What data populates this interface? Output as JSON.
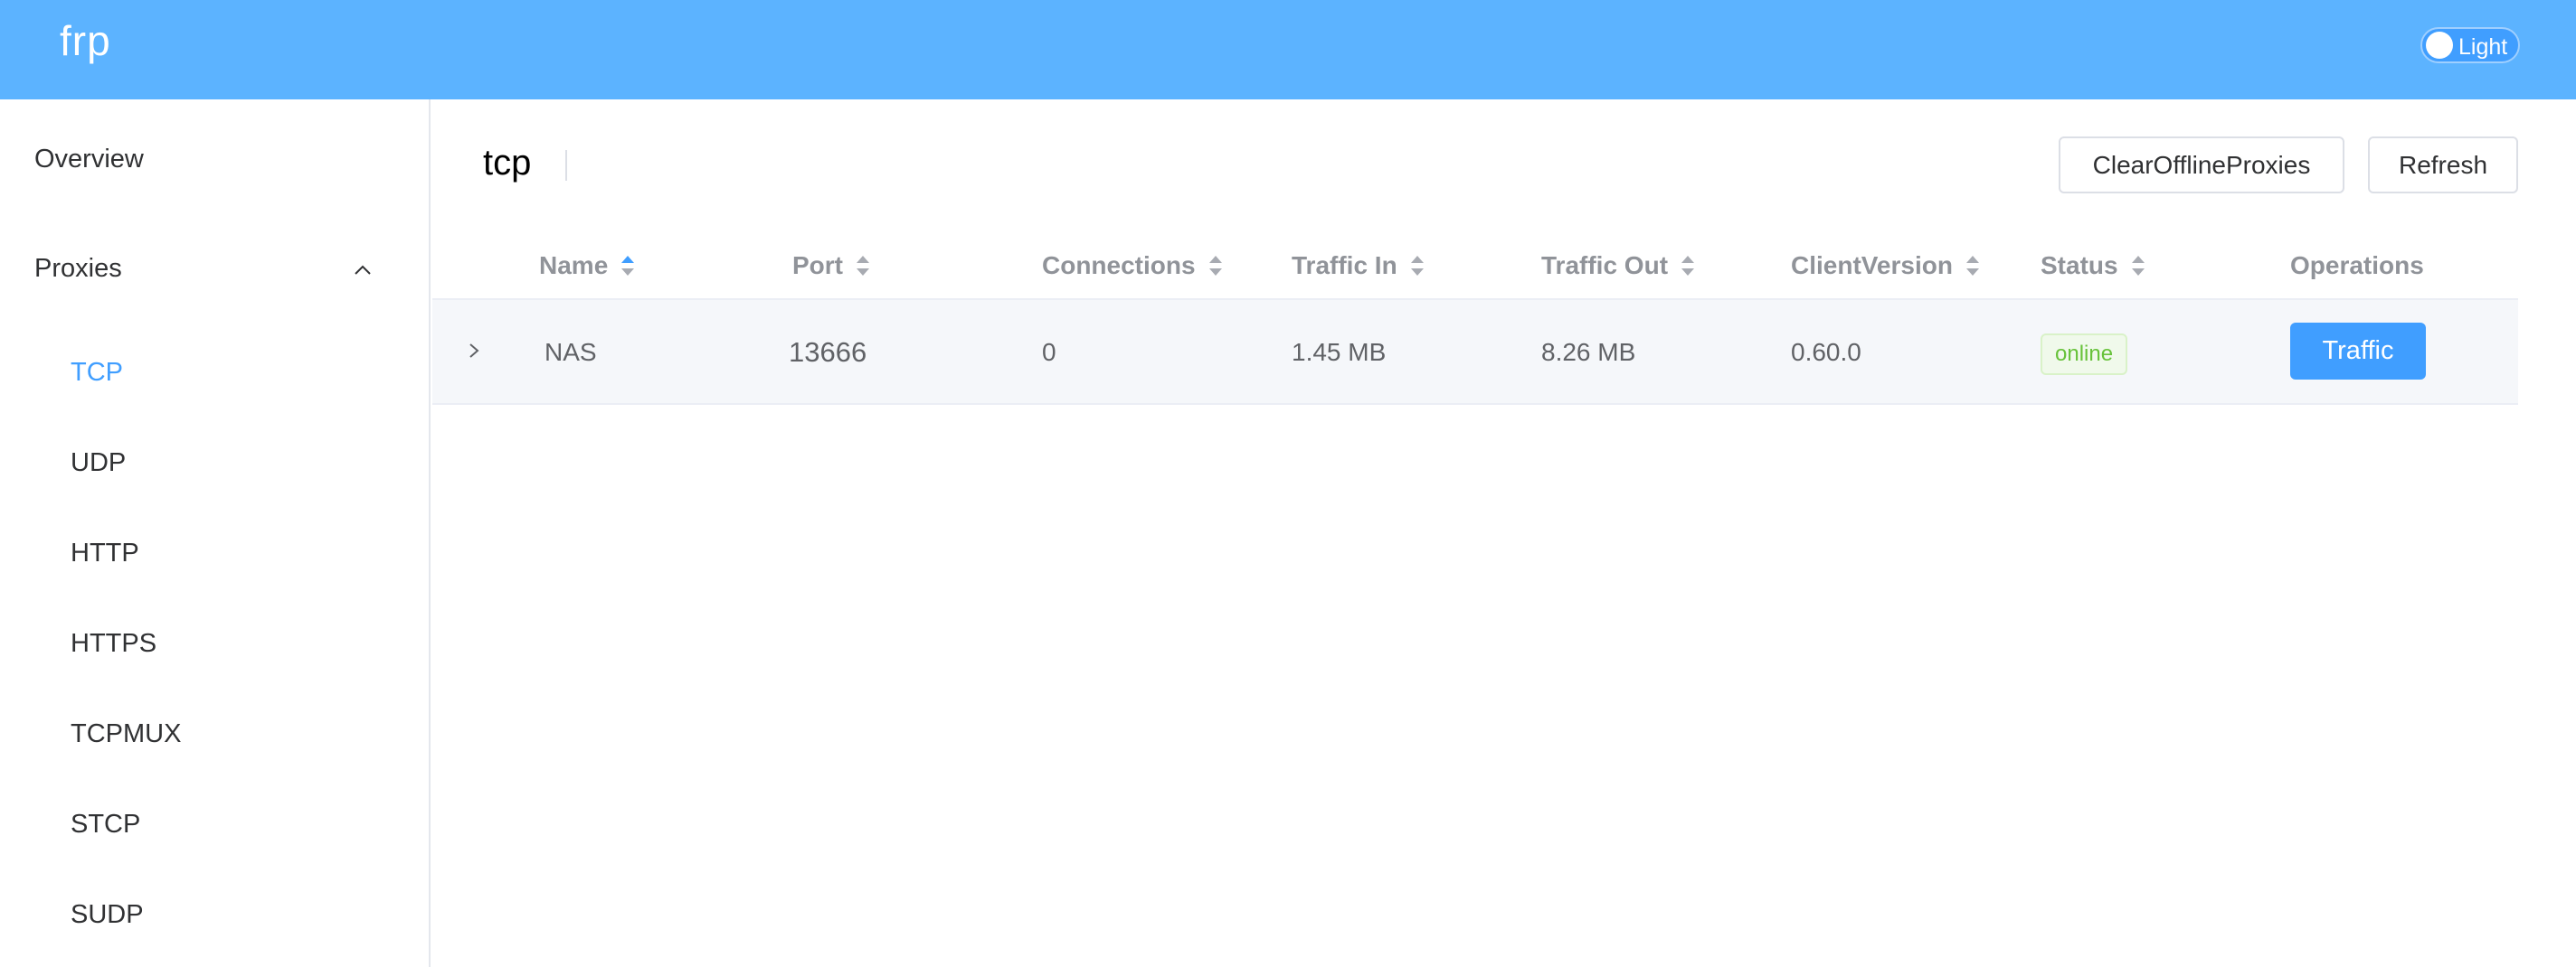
{
  "header": {
    "logo": "frp",
    "theme_label": "Light"
  },
  "sidebar": {
    "items": [
      {
        "label": "Overview"
      },
      {
        "label": "Proxies"
      }
    ],
    "proxy_types": [
      {
        "label": "TCP"
      },
      {
        "label": "UDP"
      },
      {
        "label": "HTTP"
      },
      {
        "label": "HTTPS"
      },
      {
        "label": "TCPMUX"
      },
      {
        "label": "STCP"
      },
      {
        "label": "SUDP"
      }
    ],
    "active": "TCP"
  },
  "main": {
    "title": "tcp",
    "clear_button": "ClearOfflineProxies",
    "refresh_button": "Refresh"
  },
  "table": {
    "columns": [
      "Name",
      "Port",
      "Connections",
      "Traffic In",
      "Traffic Out",
      "ClientVersion",
      "Status",
      "Operations"
    ],
    "rows": [
      {
        "name": "NAS",
        "port": "13666",
        "connections": "0",
        "traffic_in": "1.45 MB",
        "traffic_out": "8.26 MB",
        "client_version": "0.60.0",
        "status": "online",
        "operation": "Traffic"
      }
    ]
  },
  "colors": {
    "header_bg": "#5cb3ff",
    "accent": "#409eff",
    "online": "#67c23a"
  }
}
